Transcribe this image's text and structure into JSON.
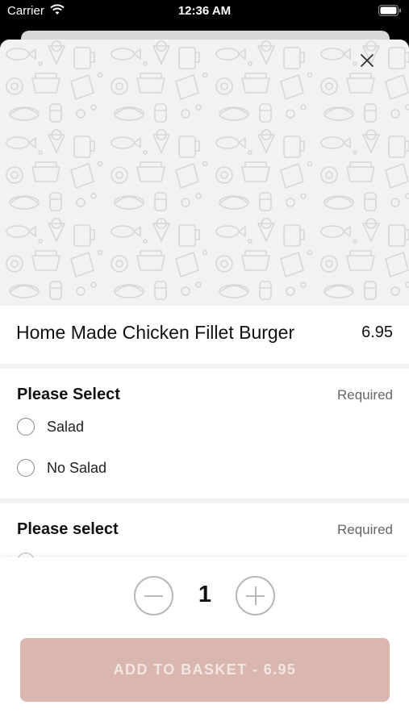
{
  "status_bar": {
    "carrier": "Carrier",
    "time": "12:36 AM"
  },
  "item": {
    "name": "Home Made Chicken Fillet Burger",
    "price": "6.95"
  },
  "option_groups": [
    {
      "title": "Please Select",
      "requirement": "Required",
      "options": [
        "Salad",
        "No Salad"
      ]
    },
    {
      "title": "Please select",
      "requirement": "Required",
      "options": []
    }
  ],
  "quantity": {
    "value": "1"
  },
  "add_button": {
    "label": "ADD TO BASKET  -  6.95"
  },
  "colors": {
    "accent_button": "#d9b7ae",
    "hero_pattern_bg": "#f2f2f2"
  },
  "icons": {
    "close": "close-icon",
    "wifi": "wifi-icon",
    "battery": "battery-icon",
    "minus": "minus-icon",
    "plus": "plus-icon"
  }
}
